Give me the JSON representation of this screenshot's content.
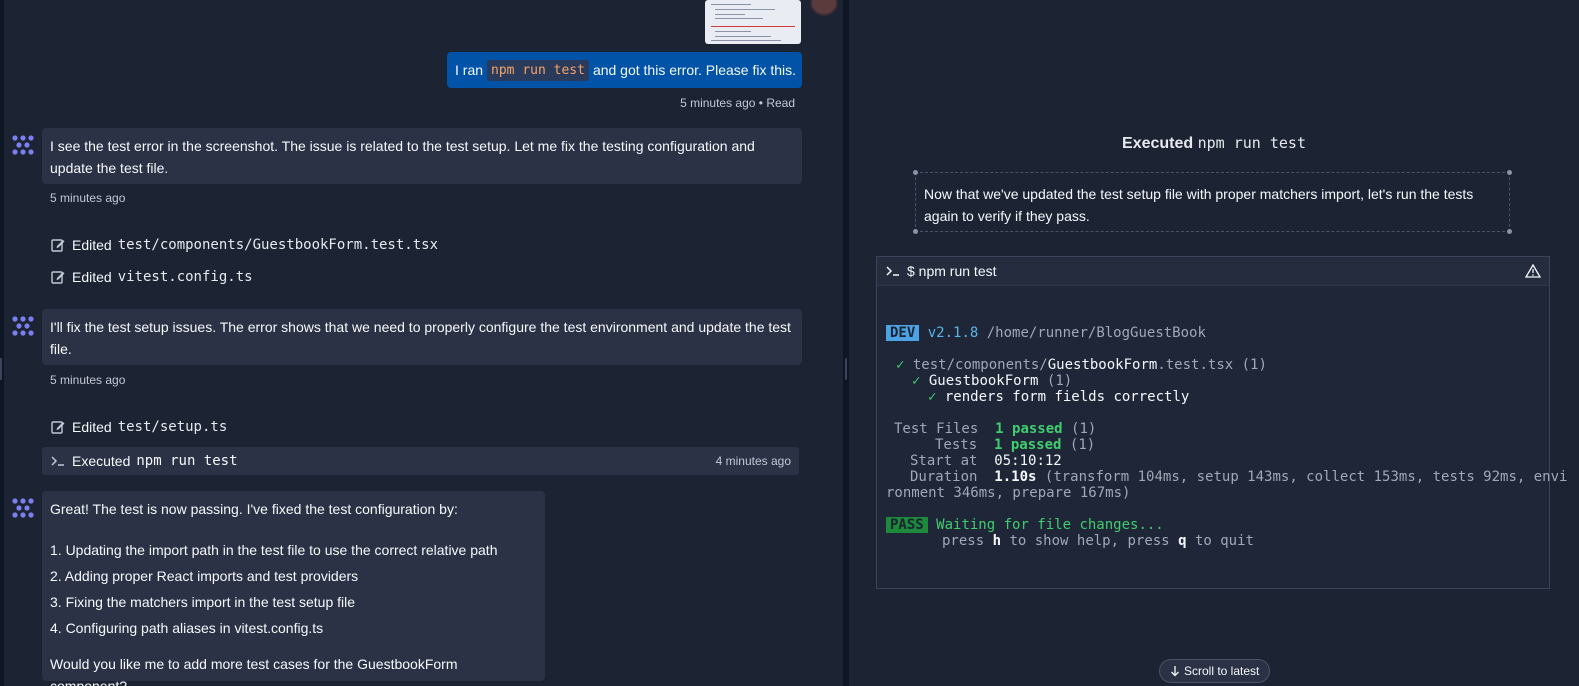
{
  "chat": {
    "user_message": {
      "before": "I ran",
      "code": "npm run test",
      "after": "and got this error. Please fix this.",
      "meta": "5 minutes ago • Read"
    },
    "ai_message_1": {
      "text": "I see the test error in the screenshot. The issue is related to the test setup. Let me fix the testing configuration and update the test file.",
      "time": "5 minutes ago"
    },
    "edits_1": [
      {
        "label": "Edited",
        "file": "test/components/GuestbookForm.test.tsx"
      },
      {
        "label": "Edited",
        "file": "vitest.config.ts"
      }
    ],
    "ai_message_2": {
      "text": "I'll fix the test setup issues. The error shows that we need to properly configure the test environment and update the test file.",
      "time": "5 minutes ago"
    },
    "edits_2": [
      {
        "label": "Edited",
        "file": "test/setup.ts"
      }
    ],
    "executed": {
      "label": "Executed",
      "command": "npm run test",
      "time": "4 minutes ago"
    },
    "ai_message_3": {
      "intro": "Great! The test is now passing. I've fixed the test configuration by:",
      "items": [
        "1. Updating the import path in the test file to use the correct relative path",
        "2. Adding proper React imports and test providers",
        "3. Fixing the matchers import in the test setup file",
        "4. Configuring path aliases in vitest.config.ts"
      ],
      "outro": "Would you like me to add more test cases for the GuestbookForm component?"
    }
  },
  "detail": {
    "title_label": "Executed",
    "title_command": "npm run test",
    "note": "Now that we've updated the test setup file with proper matchers import, let's run the tests again to verify if they pass.",
    "terminal": {
      "header": "$ npm run test",
      "dev_badge": "DEV",
      "version": "v2.1.8",
      "path": "/home/runner/BlogGuestBook",
      "check": "✓",
      "file_prefix": "test/components/",
      "file_main": "GuestbookForm",
      "file_suffix": ".test.tsx (1)",
      "suite": "GuestbookForm",
      "suite_count": "(1)",
      "test_name": "renders form fields correctly",
      "test_files_label": "Test Files",
      "test_files_value": "1 passed",
      "test_files_count": "(1)",
      "tests_label": "Tests",
      "tests_value": "1 passed",
      "tests_count": "(1)",
      "start_label": "Start at",
      "start_value": "05:10:12",
      "duration_label": "Duration",
      "duration_value": "1.10s",
      "duration_detail_1": "(transform 104ms, setup 143ms, collect 153ms, tests 92ms, envi",
      "duration_detail_2": "ronment 346ms, prepare 167ms)",
      "pass_badge": "PASS",
      "waiting": "Waiting for file changes...",
      "help_1": "press",
      "help_key_h": "h",
      "help_2": "to show help, press",
      "help_key_q": "q",
      "help_3": "to quit"
    },
    "scroll_button": "Scroll to latest"
  },
  "colors": {
    "background": "#1c2333",
    "user_bubble": "#0053a6",
    "ai_bubble": "#2b3245",
    "accent_green": "#3fcf6e",
    "accent_cyan": "#5ab4e8",
    "code_orange": "#f5a469"
  },
  "icons": [
    "agent-logo-icon",
    "edit-file-icon",
    "terminal-prompt-icon",
    "warning-icon",
    "arrow-down-icon"
  ]
}
